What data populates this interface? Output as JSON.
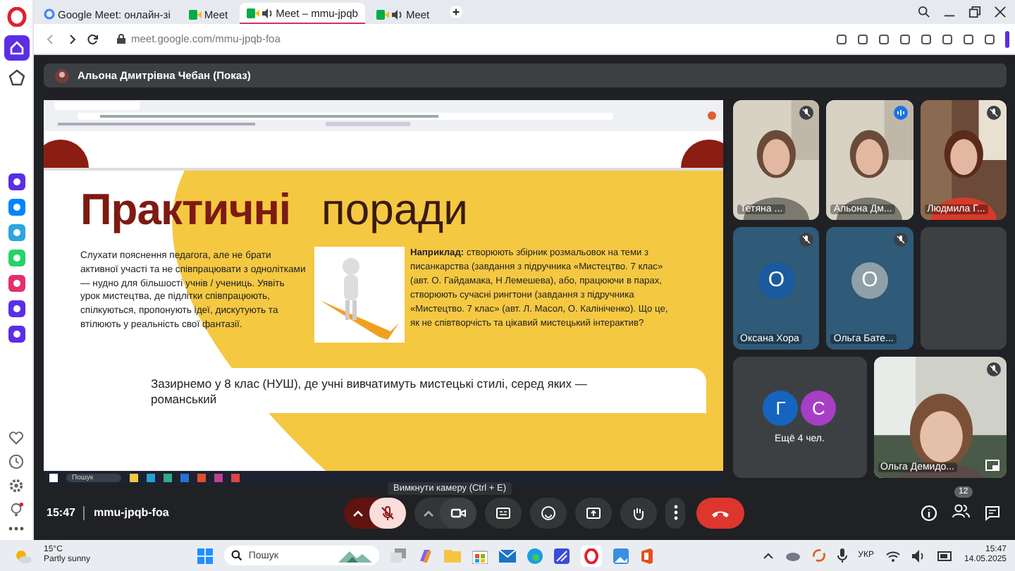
{
  "browser": {
    "tabs": [
      {
        "title": "Google Meet: онлайн-зі",
        "kind": "google",
        "selected": false
      },
      {
        "title": "Meet",
        "kind": "meet",
        "selected": false
      },
      {
        "title": "Meet – mmu-jpqb",
        "kind": "meet-audio",
        "selected": true
      },
      {
        "title": "Meet",
        "kind": "meet-audio",
        "selected": false
      }
    ],
    "url": "meet.google.com/mmu-jpqb-foa"
  },
  "presenter": {
    "name": "Альона Дмитрівна Чебан (Показ)"
  },
  "slide": {
    "title_strong": "Практичні",
    "title_rest": "поради",
    "left_text": "Слухати пояснення педагога, але не брати активної участі та не співпрацювати з однолітками — нудно для більшості учнів / учениць. Уявіть урок мистецтва, де підлітки співпрацюють, спілкуються, пропонують ідеї, дискутують та втілюють у реальність свої фантазії.",
    "example_text": "**Наприклад:** створюють збірник розмальовок на теми з писанкарства (завдання з підручника «Мистецтво. 7 клас» (авт. О. Гайдамака, Н Лемешева), або, працюючи в парах, створюють сучасні рингтони (завдання з підручника «Мистецтво. 7 клас» (авт. Л. Масол, О. Калініченко). Що це, як не співтворчість та цікавий мистецький інтерактив?",
    "bottom_text": "Зазирнемо у 8 клас (НУШ), де учні вивчатимуть мистецькі стилі, серед яких — романський",
    "taskbar_search": "Пошук"
  },
  "participants": [
    {
      "kind": "video",
      "name": "Тетяна ...",
      "muted": true,
      "speaking": false
    },
    {
      "kind": "video",
      "name": "Альона Дм...",
      "muted": false,
      "speaking": true
    },
    {
      "kind": "video",
      "name": "Людмила Г...",
      "muted": true,
      "speaking": false
    },
    {
      "kind": "avatar",
      "name": "Оксана Хора",
      "letter": "О",
      "color": "#1a5a9e",
      "muted": true,
      "speaking": false
    },
    {
      "kind": "avatar",
      "name": "Ольга Бате...",
      "letter": "О",
      "color": "#8fa0a8",
      "muted": true,
      "speaking": false
    },
    {
      "kind": "empty"
    },
    {
      "kind": "more",
      "name": "Ещё 4 чел.",
      "avatars": [
        {
          "letter": "Г",
          "color": "#1565c0"
        },
        {
          "letter": "С",
          "color": "#a63fc4"
        }
      ]
    },
    {
      "kind": "video",
      "name": "Ольга Демидо...",
      "muted": true
    }
  ],
  "controls": {
    "time": "15:47",
    "code": "mmu-jpqb-foa",
    "mic_muted": true,
    "camera_on": true,
    "tooltip": "Вимкнути камеру (Ctrl + E)",
    "people_count": "12"
  },
  "taskbar": {
    "temp": "15°C",
    "weather": "Partly sunny",
    "search": "Пошук",
    "language": "УКР",
    "time": "15:47",
    "date": "14.05.2025"
  }
}
